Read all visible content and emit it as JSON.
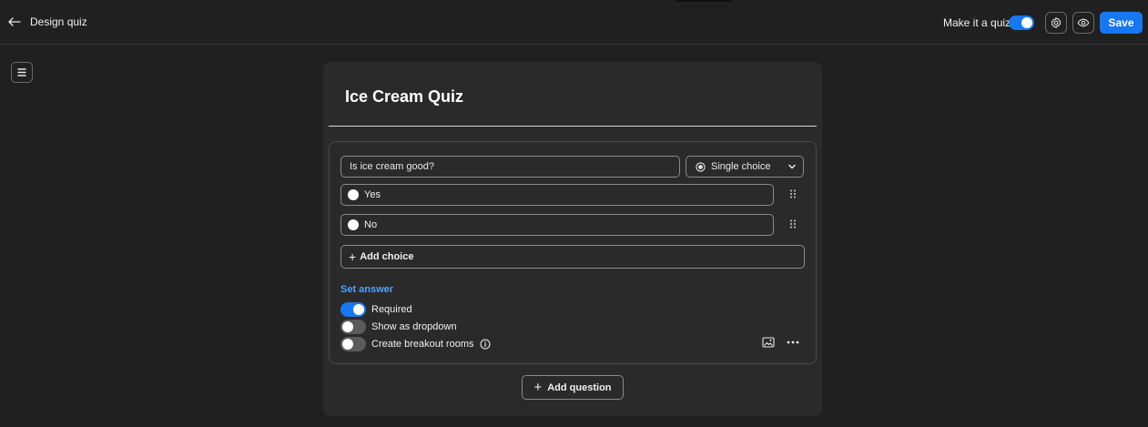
{
  "header": {
    "title": "Design quiz",
    "quiz_toggle_label": "Make it a quiz",
    "quiz_toggle_on": true,
    "save_label": "Save",
    "icons": [
      "back-arrow-icon",
      "gear-icon",
      "eye-icon"
    ]
  },
  "sidebar": {
    "menu_icon": "hamburger-icon"
  },
  "quiz": {
    "title": "Ice Cream Quiz",
    "question": {
      "text": "Is ice cream good?",
      "type": "Single choice",
      "choices": [
        {
          "label": "Yes"
        },
        {
          "label": "No"
        }
      ],
      "add_choice_label": "Add choice",
      "set_answer_label": "Set answer",
      "options": {
        "required": {
          "label": "Required",
          "on": true
        },
        "dropdown": {
          "label": "Show as dropdown",
          "on": false
        },
        "breakout": {
          "label": "Create breakout rooms",
          "on": false
        }
      }
    },
    "add_question_label": "Add question"
  },
  "colors": {
    "accent": "#1877f2",
    "link": "#4ea1ff",
    "background": "#202020",
    "card": "#2a2a2a"
  }
}
